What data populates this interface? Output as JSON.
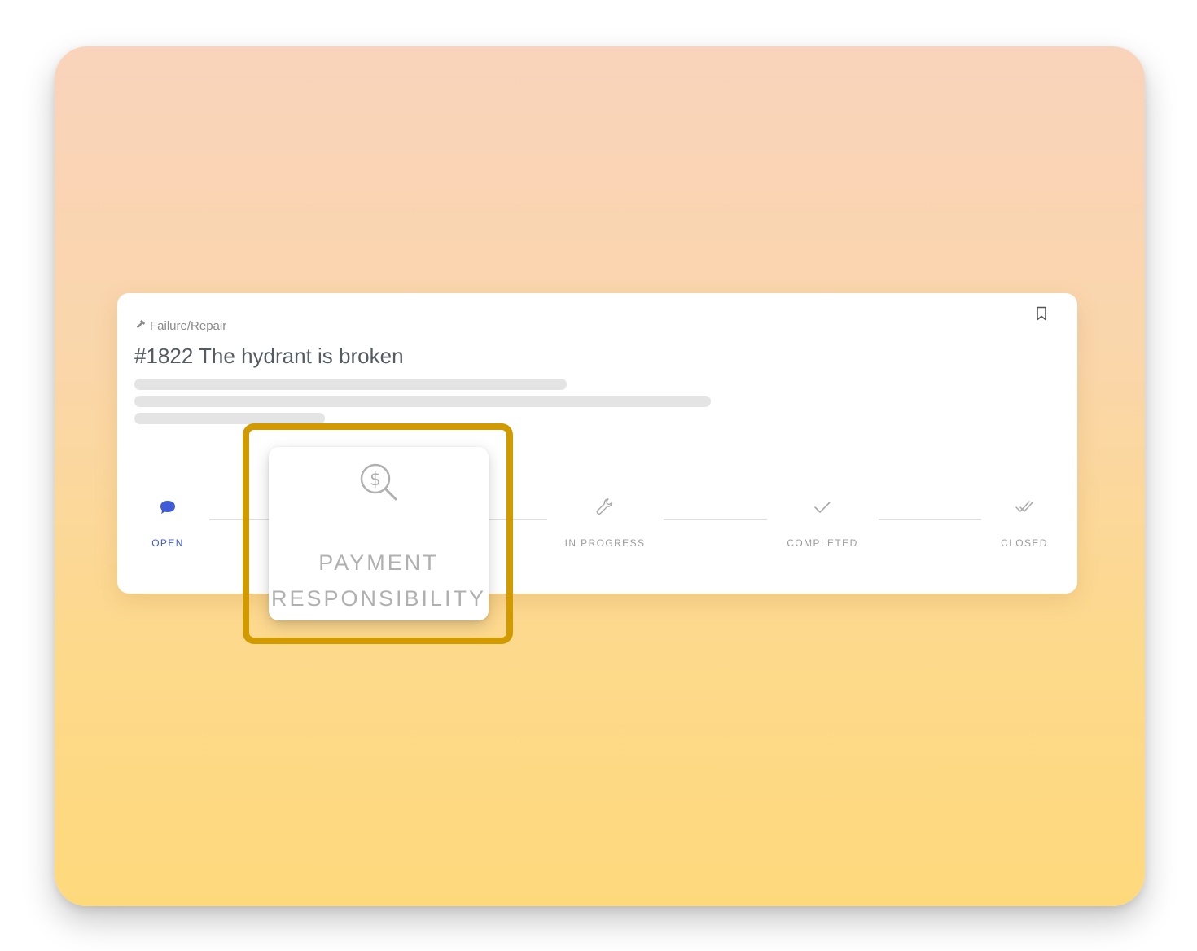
{
  "card": {
    "category": "Failure/Repair",
    "title": "#1822 The hydrant is broken"
  },
  "steps": [
    {
      "label": "OPEN",
      "icon": "chat-bubble-icon",
      "active": true
    },
    {
      "label": "IN PROGRESS",
      "icon": "wrench-icon",
      "active": false
    },
    {
      "label": "COMPLETED",
      "icon": "check-icon",
      "active": false
    },
    {
      "label": "CLOSED",
      "icon": "double-check-icon",
      "active": false
    }
  ],
  "popup": {
    "icon": "dollar-search-icon",
    "line1": "PAYMENT",
    "line2": "RESPONSIBILITY"
  },
  "colors": {
    "accent": "#3f5bd8",
    "highlight": "#d19a00",
    "frame_top": "#f9d3bb",
    "frame_bottom": "#fed97c"
  }
}
